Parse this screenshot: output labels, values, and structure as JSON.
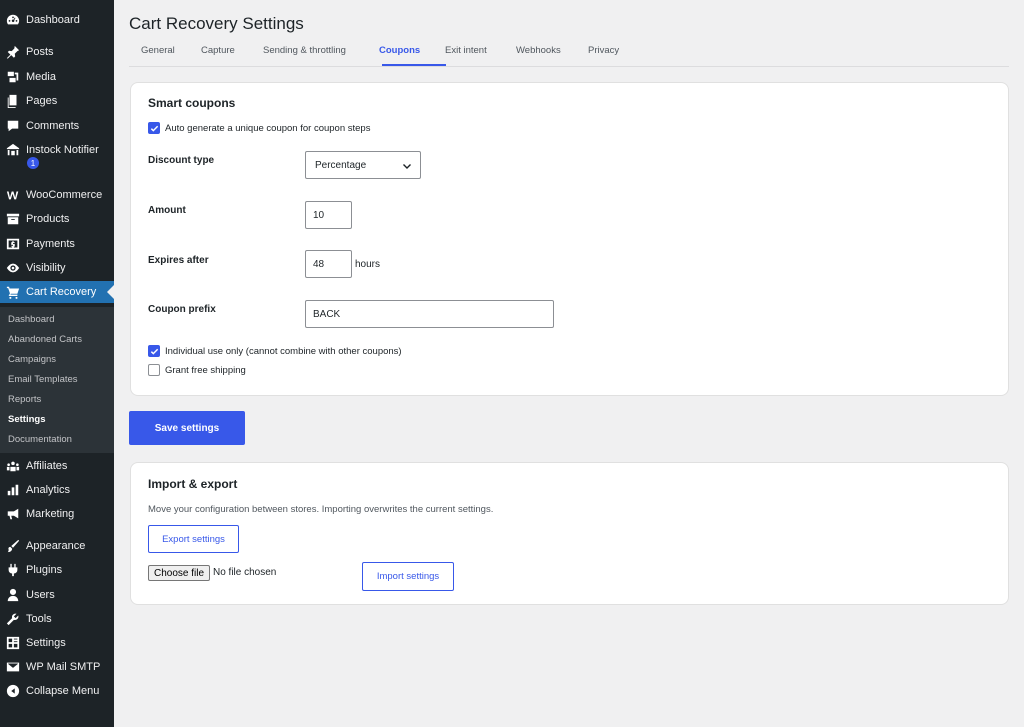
{
  "sidebar": {
    "items": [
      {
        "label": "Dashboard",
        "icon": "dashboard-icon"
      },
      {
        "label": "Posts",
        "icon": "pin-icon"
      },
      {
        "label": "Media",
        "icon": "media-icon"
      },
      {
        "label": "Pages",
        "icon": "pages-icon"
      },
      {
        "label": "Comments",
        "icon": "comment-icon"
      },
      {
        "label": "Instock Notifier",
        "icon": "store-icon"
      },
      {
        "label": "WooCommerce",
        "icon": "woo-icon"
      },
      {
        "label": "Products",
        "icon": "archive-icon"
      },
      {
        "label": "Payments",
        "icon": "money-icon"
      },
      {
        "label": "Visibility",
        "icon": "eye-icon"
      },
      {
        "label": "Cart Recovery",
        "icon": "cart-icon"
      },
      {
        "label": "Affiliates",
        "icon": "groups-icon"
      },
      {
        "label": "Analytics",
        "icon": "chart-bar-icon"
      },
      {
        "label": "Marketing",
        "icon": "megaphone-icon"
      },
      {
        "label": "Appearance",
        "icon": "brush-icon"
      },
      {
        "label": "Plugins",
        "icon": "plugin-icon"
      },
      {
        "label": "Users",
        "icon": "user-icon"
      },
      {
        "label": "Tools",
        "icon": "wrench-icon"
      },
      {
        "label": "Settings",
        "icon": "settings-icon"
      },
      {
        "label": "WP Mail SMTP",
        "icon": "mail-icon"
      },
      {
        "label": "Collapse Menu",
        "icon": "collapse-icon"
      }
    ],
    "notifier_badge": "1",
    "submenu": [
      "Dashboard",
      "Abandoned Carts",
      "Campaigns",
      "Email Templates",
      "Reports",
      "Settings",
      "Documentation"
    ]
  },
  "page": {
    "title": "Cart Recovery Settings",
    "tabs": [
      "General",
      "Capture",
      "Sending & throttling",
      "Coupons",
      "Exit intent",
      "Webhooks",
      "Privacy"
    ],
    "active_tab": "Coupons"
  },
  "smart_coupons": {
    "title": "Smart coupons",
    "auto_generate": {
      "label": "Auto generate a unique coupon for coupon steps",
      "checked": true
    },
    "discount_type": {
      "label": "Discount type",
      "value": "Percentage"
    },
    "amount": {
      "label": "Amount",
      "value": "10"
    },
    "expires": {
      "label": "Expires after",
      "value": "48",
      "suffix": "hours"
    },
    "prefix": {
      "label": "Coupon prefix",
      "value": "BACK"
    },
    "individual_use": {
      "label": "Individual use only (cannot combine with other coupons)",
      "checked": true
    },
    "free_shipping": {
      "label": "Grant free shipping",
      "checked": false
    }
  },
  "save_button": "Save settings",
  "import_export": {
    "title": "Import & export",
    "description": "Move your configuration between stores. Importing overwrites the current settings.",
    "export_button": "Export settings",
    "choose_file": "Choose file",
    "file_status": "No file chosen",
    "import_button": "Import settings"
  },
  "colors": {
    "accent": "#3858e9",
    "sidebar_bg": "#1d2327",
    "active_menu": "#2271b1"
  }
}
